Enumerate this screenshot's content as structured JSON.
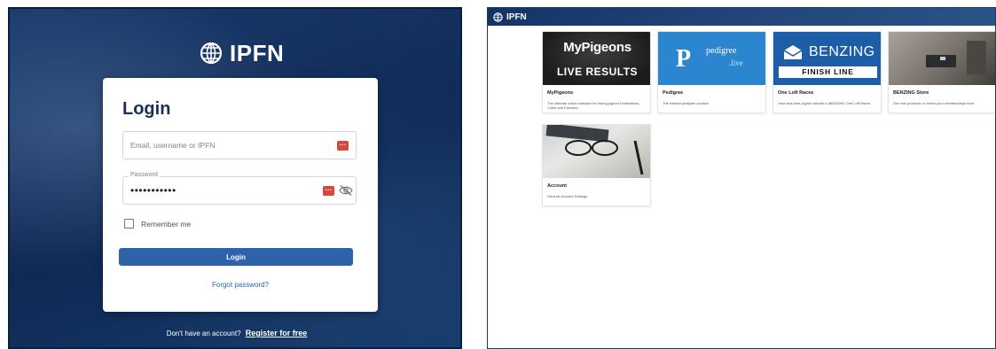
{
  "login_screen": {
    "brand": {
      "name": "IPFN",
      "icon": "globe-grid-icon"
    },
    "title": "Login",
    "username_field": {
      "placeholder": "Email, username or IPFN"
    },
    "password_field": {
      "label": "Password",
      "value": "•••••••••••"
    },
    "remember_label": "Remember me",
    "remember_checked": false,
    "login_button": "Login",
    "forgot_password": "Forgot password?",
    "register_prompt": "Don't have an account?",
    "register_link": "Register for free",
    "colors": {
      "primary": "#2d63a9",
      "background": "#163a6a",
      "password_manager": "#d9463e"
    }
  },
  "dashboard": {
    "brand": {
      "name": "IPFN",
      "icon": "globe-grid-icon"
    },
    "tiles": [
      {
        "title": "MyPigeons",
        "description": "The ultimate online software for racing pigeon Federations, Clubs and Fanciers.",
        "image_text": [
          "MyPigeons",
          "LIVE RESULTS"
        ]
      },
      {
        "title": "Pedigree",
        "description": "The easiest pedigree solution",
        "image_text": [
          "P",
          "pedigree",
          ".live"
        ]
      },
      {
        "title": "One Loft Races",
        "description": "View real-time pigeon arrivals in BENZING One Loft Races",
        "image_text": [
          "BENZING",
          "FINISH LINE"
        ]
      },
      {
        "title": "BENZING Store",
        "description": "Get new products or renew your memberships here."
      },
      {
        "title": "Account",
        "description": "General Account Settings"
      }
    ],
    "colors": {
      "topbar": "#1f4479"
    }
  }
}
